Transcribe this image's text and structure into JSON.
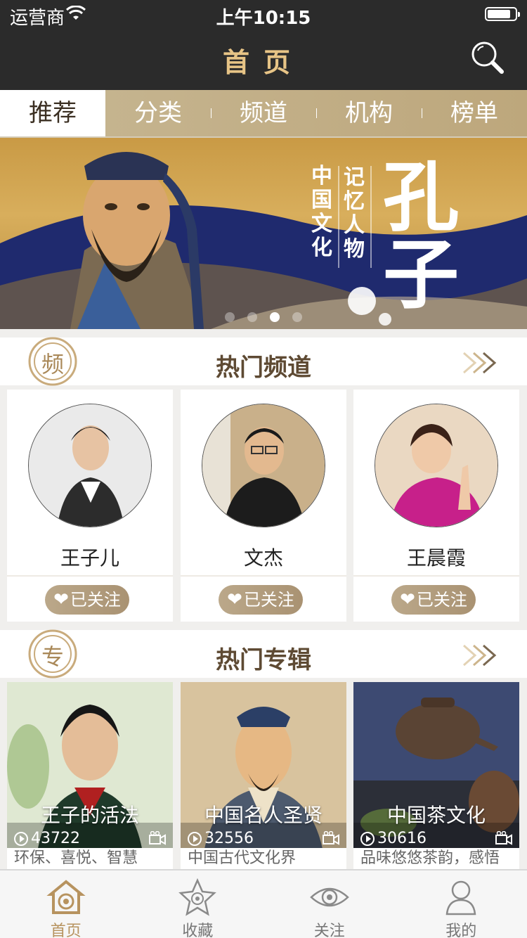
{
  "status": {
    "carrier": "运营商",
    "time": "上午10:15",
    "battery_level": 0.85
  },
  "nav": {
    "title": "首页"
  },
  "tabs": [
    {
      "label": "推荐",
      "active": true
    },
    {
      "label": "分类"
    },
    {
      "label": "频道"
    },
    {
      "label": "机构"
    },
    {
      "label": "榜单"
    }
  ],
  "banner": {
    "col1": "中国文化",
    "col2": "记忆人物",
    "big_name": "孔子",
    "page_count": 4,
    "current_page": 3
  },
  "hot_channels": {
    "badge": "频",
    "title": "热门频道",
    "items": [
      {
        "name": "王子儿",
        "follow_label": "已关注"
      },
      {
        "name": "文杰",
        "follow_label": "已关注"
      },
      {
        "name": "王晨霞",
        "follow_label": "已关注"
      }
    ]
  },
  "hot_albums": {
    "badge": "专",
    "title": "热门专辑",
    "items": [
      {
        "title": "王子的活法",
        "plays": "43722",
        "desc": "环保、喜悦、智慧"
      },
      {
        "title": "中国名人圣贤",
        "plays": "32556",
        "desc": "中国古代文化界"
      },
      {
        "title": "中国茶文化",
        "plays": "30616",
        "desc": "品味悠悠茶韵，感悟"
      }
    ]
  },
  "tabbar": [
    {
      "label": "首页",
      "active": true
    },
    {
      "label": "收藏"
    },
    {
      "label": "关注"
    },
    {
      "label": "我的"
    }
  ],
  "colors": {
    "accent": "#b7935f",
    "nav_bg": "#2b2b2b",
    "title_gold": "#e7c486"
  }
}
